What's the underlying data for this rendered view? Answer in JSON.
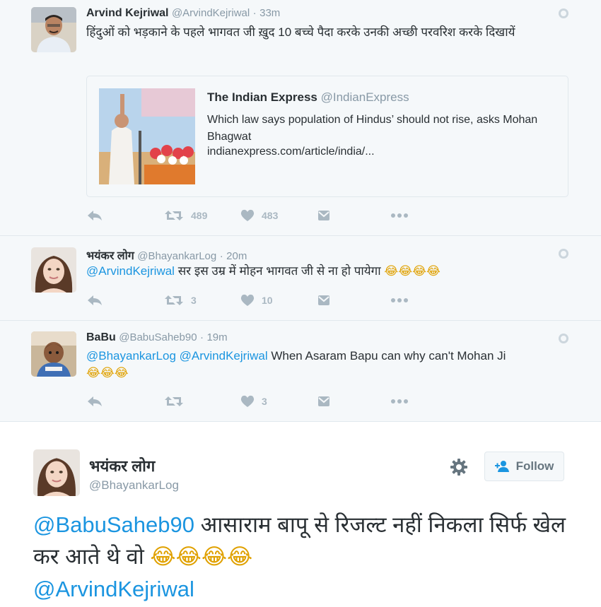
{
  "tweets": [
    {
      "name": "Arvind Kejriwal",
      "handle": "@ArvindKejriwal",
      "sep": "·",
      "time": "33m",
      "text": "हिंदुओं को भड़काने के पहले भागवत जी ख़ुद 10 बच्चे पैदा करके उनकी अच्छी परवरिश करके दिखायें",
      "card": {
        "source_name": "The Indian Express",
        "source_handle": "@IndianExpress",
        "description": "Which law says population of Hindus’ should not rise, asks Mohan Bhagwat",
        "url": "indianexpress.com/article/india/..."
      },
      "retweets": "489",
      "likes": "483"
    },
    {
      "name": "भयंकर लोग",
      "handle": "@BhayankarLog",
      "sep": "·",
      "time": "20m",
      "mention": "@ArvindKejriwal",
      "text": " सर इस उम्र में मोहन भागवत जी से ना हो पायेगा ",
      "emoji": "😂😂😂😂",
      "retweets": "3",
      "likes": "10"
    },
    {
      "name": "BaBu",
      "handle": "@BabuSaheb90",
      "sep": "·",
      "time": "19m",
      "mention1": "@BhayankarLog",
      "mention2": "@ArvindKejriwal",
      "text": " When Asaram Bapu can why can't Mohan Ji",
      "emoji": "😂😂😂",
      "retweets": "",
      "likes": "3"
    }
  ],
  "expanded": {
    "name": "भयंकर लोग",
    "handle": "@BhayankarLog",
    "follow_label": "Follow",
    "mention1": "@BabuSaheb90",
    "text1": " आसाराम बापू से रिजल्ट नहीं निकला सिर्फ खेल कर आते थे वो ",
    "emoji": "😂😂😂😂",
    "mention2": "@ArvindKejriwal"
  },
  "colors": {
    "link": "#1b95e0",
    "muted": "#8899a6",
    "action": "#aab8c2"
  },
  "icons": [
    "reply-icon",
    "retweet-icon",
    "like-icon",
    "dm-icon",
    "more-icon",
    "globe-icon",
    "gear-icon",
    "follow-user-icon"
  ]
}
